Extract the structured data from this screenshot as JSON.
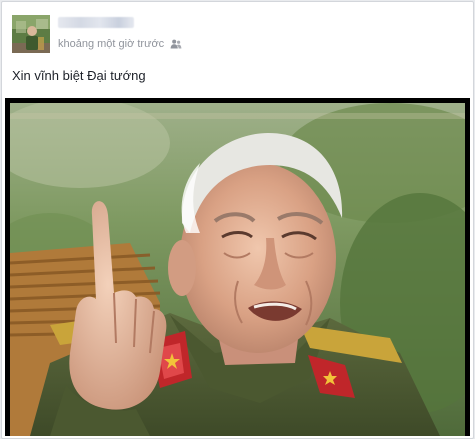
{
  "post": {
    "author_name": "",
    "timestamp": "khoảng một giờ trước",
    "audience_icon": "friends-icon",
    "text": "Xin vĩnh biệt Đại tướng"
  },
  "colors": {
    "meta_text": "#90949c",
    "body_text": "#1d2129",
    "card_border": "#d3d6db",
    "photo_frame": "#000000"
  }
}
